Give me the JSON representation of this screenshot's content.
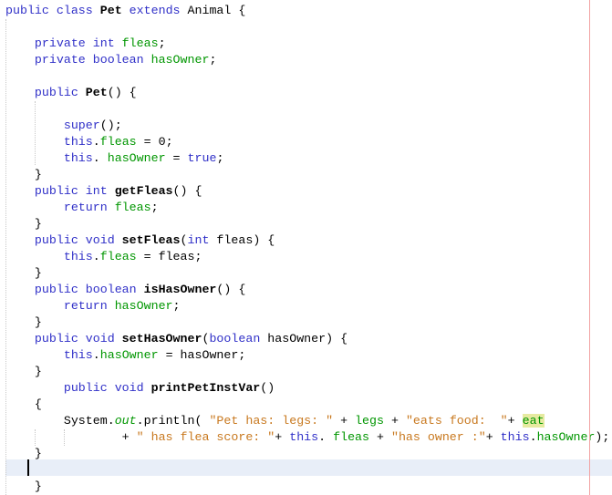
{
  "editor": {
    "language": "java",
    "caret_line": 29,
    "highlighted_occurrence": "eat",
    "lines": [
      [
        {
          "t": "public class ",
          "c": "kw"
        },
        {
          "t": "Pet",
          "c": "bold"
        },
        {
          "t": " extends ",
          "c": "kw"
        },
        {
          "t": "Animal {",
          "c": ""
        }
      ],
      [],
      [
        {
          "t": "    private int ",
          "c": "kw"
        },
        {
          "t": "fleas",
          "c": "fld"
        },
        {
          "t": ";",
          "c": ""
        }
      ],
      [
        {
          "t": "    private boolean ",
          "c": "kw"
        },
        {
          "t": "hasOwner",
          "c": "fld"
        },
        {
          "t": ";",
          "c": ""
        }
      ],
      [],
      [
        {
          "t": "    public ",
          "c": "kw"
        },
        {
          "t": "Pet",
          "c": "bold"
        },
        {
          "t": "() {",
          "c": ""
        }
      ],
      [],
      [
        {
          "t": "        super",
          "c": "kw"
        },
        {
          "t": "();",
          "c": ""
        }
      ],
      [
        {
          "t": "        this",
          "c": "kw"
        },
        {
          "t": ".",
          "c": ""
        },
        {
          "t": "fleas",
          "c": "fld"
        },
        {
          "t": " = 0;",
          "c": ""
        }
      ],
      [
        {
          "t": "        this",
          "c": "kw"
        },
        {
          "t": ". ",
          "c": ""
        },
        {
          "t": "hasOwner",
          "c": "fld"
        },
        {
          "t": " = ",
          "c": ""
        },
        {
          "t": "true",
          "c": "kw"
        },
        {
          "t": ";",
          "c": ""
        }
      ],
      [
        {
          "t": "    }",
          "c": ""
        }
      ],
      [
        {
          "t": "    public int ",
          "c": "kw"
        },
        {
          "t": "getFleas",
          "c": "bold"
        },
        {
          "t": "() {",
          "c": ""
        }
      ],
      [
        {
          "t": "        return ",
          "c": "kw"
        },
        {
          "t": "fleas",
          "c": "fld"
        },
        {
          "t": ";",
          "c": ""
        }
      ],
      [
        {
          "t": "    }",
          "c": ""
        }
      ],
      [
        {
          "t": "    public void ",
          "c": "kw"
        },
        {
          "t": "setFleas",
          "c": "bold"
        },
        {
          "t": "(",
          "c": ""
        },
        {
          "t": "int",
          "c": "kw"
        },
        {
          "t": " fleas) {",
          "c": ""
        }
      ],
      [
        {
          "t": "        this",
          "c": "kw"
        },
        {
          "t": ".",
          "c": ""
        },
        {
          "t": "fleas",
          "c": "fld"
        },
        {
          "t": " = fleas;",
          "c": ""
        }
      ],
      [
        {
          "t": "    }",
          "c": ""
        }
      ],
      [
        {
          "t": "    public boolean ",
          "c": "kw"
        },
        {
          "t": "isHasOwner",
          "c": "bold"
        },
        {
          "t": "() {",
          "c": ""
        }
      ],
      [
        {
          "t": "        return ",
          "c": "kw"
        },
        {
          "t": "hasOwner",
          "c": "fld"
        },
        {
          "t": ";",
          "c": ""
        }
      ],
      [
        {
          "t": "    }",
          "c": ""
        }
      ],
      [
        {
          "t": "    public void ",
          "c": "kw"
        },
        {
          "t": "setHasOwner",
          "c": "bold"
        },
        {
          "t": "(",
          "c": ""
        },
        {
          "t": "boolean",
          "c": "kw"
        },
        {
          "t": " hasOwner) {",
          "c": ""
        }
      ],
      [
        {
          "t": "        this",
          "c": "kw"
        },
        {
          "t": ".",
          "c": ""
        },
        {
          "t": "hasOwner",
          "c": "fld"
        },
        {
          "t": " = hasOwner;",
          "c": ""
        }
      ],
      [
        {
          "t": "    }",
          "c": ""
        }
      ],
      [
        {
          "t": "        public void ",
          "c": "kw"
        },
        {
          "t": "printPetInstVar",
          "c": "bold"
        },
        {
          "t": "()",
          "c": ""
        }
      ],
      [
        {
          "t": "    {",
          "c": ""
        }
      ],
      [
        {
          "t": "        System.",
          "c": ""
        },
        {
          "t": "out",
          "c": "st"
        },
        {
          "t": ".println( ",
          "c": ""
        },
        {
          "t": "\"Pet has: legs: \"",
          "c": "str"
        },
        {
          "t": " + ",
          "c": ""
        },
        {
          "t": "legs",
          "c": "fld"
        },
        {
          "t": " + ",
          "c": ""
        },
        {
          "t": "\"eats food:  \"",
          "c": "str"
        },
        {
          "t": "+ ",
          "c": ""
        },
        {
          "t": "eat",
          "c": "fld hl"
        }
      ],
      [
        {
          "t": "                ",
          "c": ""
        },
        {
          "t": "+ ",
          "c": ""
        },
        {
          "t": "\" has flea score: \"",
          "c": "str"
        },
        {
          "t": "+ ",
          "c": ""
        },
        {
          "t": "this",
          "c": "kw"
        },
        {
          "t": ". ",
          "c": ""
        },
        {
          "t": "fleas",
          "c": "fld"
        },
        {
          "t": " + ",
          "c": ""
        },
        {
          "t": "\"has owner :\"",
          "c": "str"
        },
        {
          "t": "+ ",
          "c": ""
        },
        {
          "t": "this",
          "c": "kw"
        },
        {
          "t": ".",
          "c": ""
        },
        {
          "t": "hasOwner",
          "c": "fld"
        },
        {
          "t": ");",
          "c": ""
        }
      ],
      [
        {
          "t": "    }",
          "c": ""
        }
      ],
      [],
      [
        {
          "t": "    }",
          "c": ""
        }
      ]
    ]
  }
}
